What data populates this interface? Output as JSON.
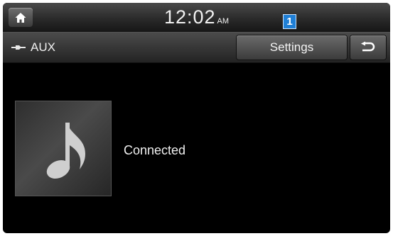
{
  "status_bar": {
    "home_icon": "home-icon",
    "time": "12:02",
    "ampm": "AM"
  },
  "toolbar": {
    "source_icon": "aux-plug-icon",
    "source_label": "AUX",
    "settings_label": "Settings",
    "back_icon": "back-arrow-icon"
  },
  "callout": {
    "number": "1",
    "color": "#1f7fd6"
  },
  "main": {
    "album_icon": "music-note-icon",
    "status": "Connected"
  }
}
